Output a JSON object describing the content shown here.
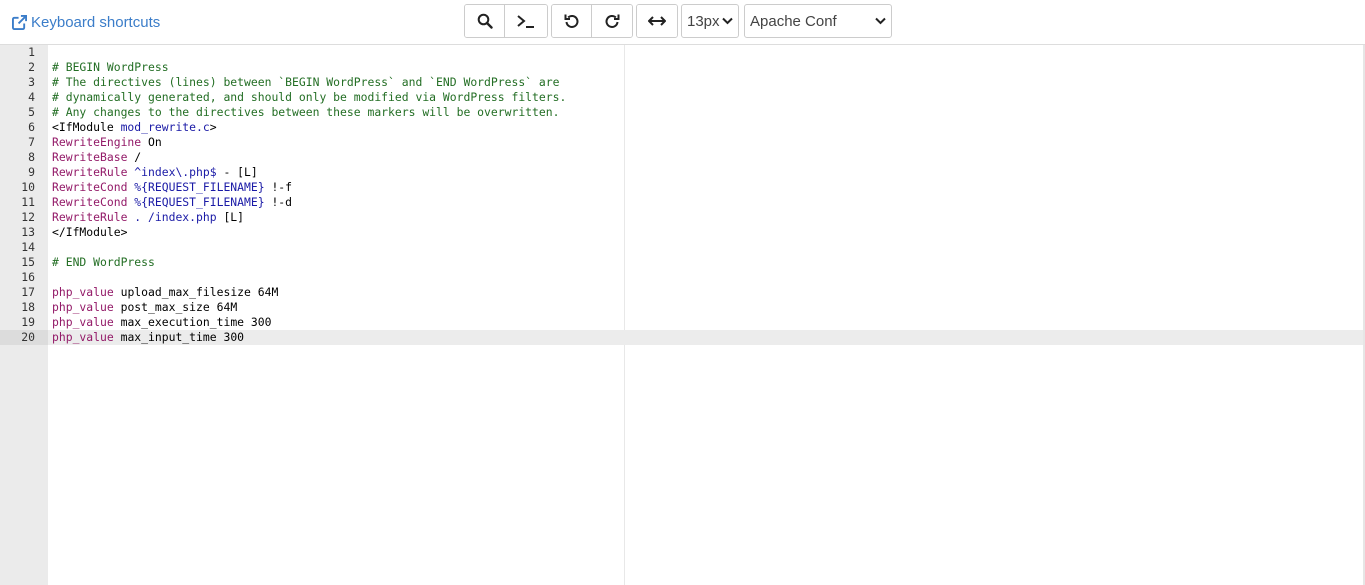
{
  "toolbar": {
    "keyboard_shortcuts_label": "Keyboard shortcuts",
    "font_size_value": "13px",
    "mode_value": "Apache Conf",
    "link_color": "#3b7dc9"
  },
  "icons": {
    "external_link": "external-link-icon",
    "search": "search-icon",
    "terminal": "terminal-icon",
    "undo": "undo-icon",
    "redo": "redo-icon",
    "wrap": "horizontal-arrows-icon",
    "dropdown": "chevron-down-icon"
  },
  "editor": {
    "active_line": 20,
    "lines": [
      {
        "num": "1",
        "tokens": []
      },
      {
        "num": "2",
        "tokens": [
          {
            "cls": "t-comment",
            "text": "# BEGIN WordPress"
          }
        ]
      },
      {
        "num": "3",
        "tokens": [
          {
            "cls": "t-comment",
            "text": "# The directives (lines) between `BEGIN WordPress` and `END WordPress` are"
          }
        ]
      },
      {
        "num": "4",
        "tokens": [
          {
            "cls": "t-comment",
            "text": "# dynamically generated, and should only be modified via WordPress filters."
          }
        ]
      },
      {
        "num": "5",
        "tokens": [
          {
            "cls": "t-comment",
            "text": "# Any changes to the directives between these markers will be overwritten."
          }
        ]
      },
      {
        "num": "6",
        "tokens": [
          {
            "cls": "t-tag",
            "text": "<IfModule "
          },
          {
            "cls": "t-value",
            "text": "mod_rewrite.c"
          },
          {
            "cls": "t-tag",
            "text": ">"
          }
        ]
      },
      {
        "num": "7",
        "tokens": [
          {
            "cls": "t-keyword",
            "text": "RewriteEngine"
          },
          {
            "cls": "t-plain",
            "text": " On"
          }
        ]
      },
      {
        "num": "8",
        "tokens": [
          {
            "cls": "t-keyword",
            "text": "RewriteBase"
          },
          {
            "cls": "t-plain",
            "text": " /"
          }
        ]
      },
      {
        "num": "9",
        "tokens": [
          {
            "cls": "t-keyword",
            "text": "RewriteRule"
          },
          {
            "cls": "t-value",
            "text": " ^index\\.php$"
          },
          {
            "cls": "t-plain",
            "text": " - [L]"
          }
        ]
      },
      {
        "num": "10",
        "tokens": [
          {
            "cls": "t-keyword",
            "text": "RewriteCond"
          },
          {
            "cls": "t-value",
            "text": " %{REQUEST_FILENAME}"
          },
          {
            "cls": "t-plain",
            "text": " !-f"
          }
        ]
      },
      {
        "num": "11",
        "tokens": [
          {
            "cls": "t-keyword",
            "text": "RewriteCond"
          },
          {
            "cls": "t-value",
            "text": " %{REQUEST_FILENAME}"
          },
          {
            "cls": "t-plain",
            "text": " !-d"
          }
        ]
      },
      {
        "num": "12",
        "tokens": [
          {
            "cls": "t-keyword",
            "text": "RewriteRule"
          },
          {
            "cls": "t-value",
            "text": " . /index.php"
          },
          {
            "cls": "t-plain",
            "text": " [L]"
          }
        ]
      },
      {
        "num": "13",
        "tokens": [
          {
            "cls": "t-tag",
            "text": "</IfModule>"
          }
        ]
      },
      {
        "num": "14",
        "tokens": []
      },
      {
        "num": "15",
        "tokens": [
          {
            "cls": "t-comment",
            "text": "# END WordPress"
          }
        ]
      },
      {
        "num": "16",
        "tokens": []
      },
      {
        "num": "17",
        "tokens": [
          {
            "cls": "t-keyword",
            "text": "php_value"
          },
          {
            "cls": "t-plain",
            "text": " upload_max_filesize 64M"
          }
        ]
      },
      {
        "num": "18",
        "tokens": [
          {
            "cls": "t-keyword",
            "text": "php_value"
          },
          {
            "cls": "t-plain",
            "text": " post_max_size 64M"
          }
        ]
      },
      {
        "num": "19",
        "tokens": [
          {
            "cls": "t-keyword",
            "text": "php_value"
          },
          {
            "cls": "t-plain",
            "text": " max_execution_time 300"
          }
        ]
      },
      {
        "num": "20",
        "tokens": [
          {
            "cls": "t-keyword",
            "text": "php_value"
          },
          {
            "cls": "t-plain",
            "text": " max_input_time 300"
          }
        ]
      }
    ]
  }
}
